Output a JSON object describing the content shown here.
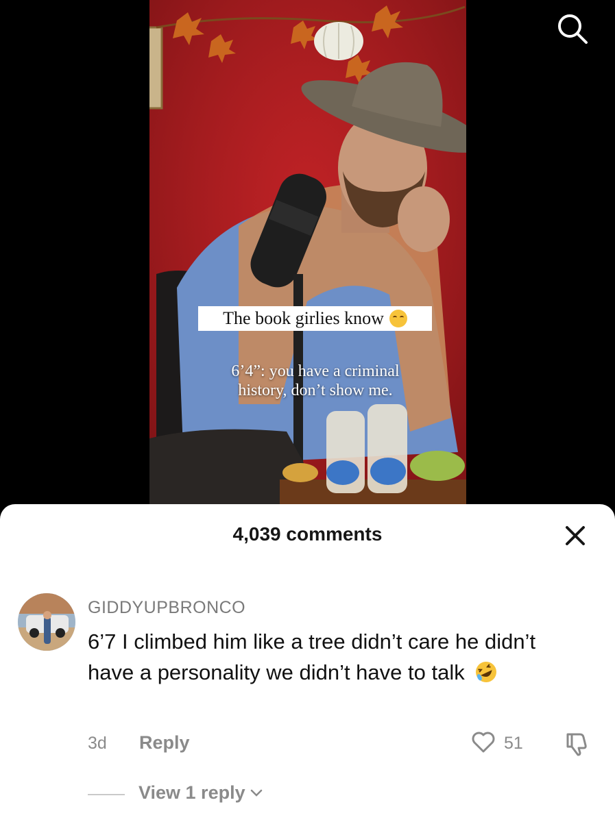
{
  "video": {
    "caption": "The book girlies know",
    "caption_emoji": "smirking-face-emoji",
    "overlay_line1": "6’4”: you have a criminal",
    "overlay_line2": "history, don’t show me.",
    "search_icon": "search-icon"
  },
  "comments_sheet": {
    "header": "4,039 comments",
    "close_icon": "close-icon",
    "comment": {
      "username": "GIDDYUPBRONCO",
      "text": "6’7 I climbed him like a tree didn’t care he didn’t have a personality we didn’t have to talk",
      "emoji": "rolling-on-floor-laughing-emoji",
      "timestamp": "3d",
      "reply_label": "Reply",
      "like_count": "51",
      "view_replies_label": "View 1 reply"
    }
  },
  "colors": {
    "video_background": "#b81f22",
    "secondary_text": "#8a8a8a",
    "primary_text": "#111111"
  }
}
